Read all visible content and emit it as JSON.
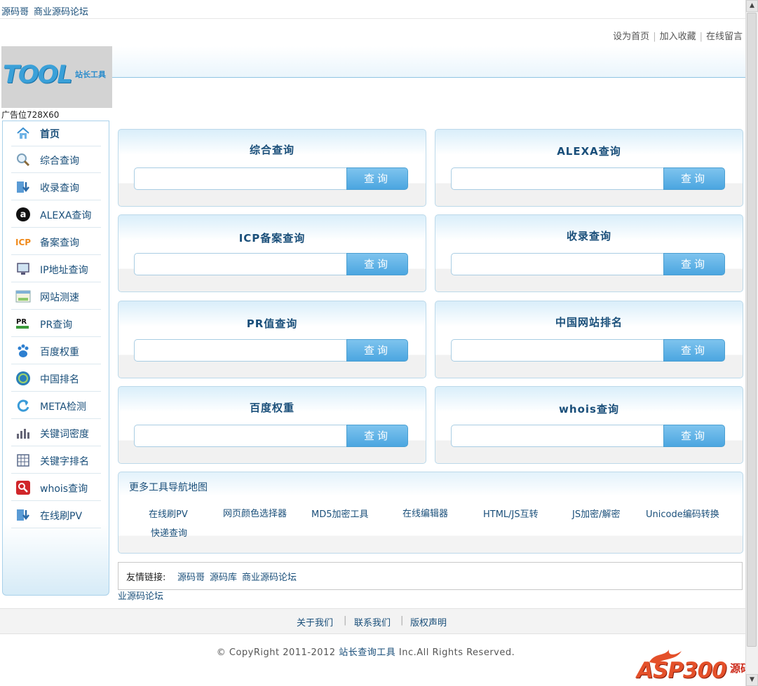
{
  "top": {
    "links": [
      "源码哥",
      "商业源码论坛"
    ],
    "right_links": [
      "设为首页",
      "加入收藏",
      "在线留言"
    ]
  },
  "logo": {
    "big": "TOOL",
    "small": "站长工具"
  },
  "ad_label": "广告位728X60",
  "sidebar": {
    "items": [
      {
        "label": "首页",
        "icon": "home-icon"
      },
      {
        "label": "综合查询",
        "icon": "magnifier-icon"
      },
      {
        "label": "收录查询",
        "icon": "download-arrow-icon"
      },
      {
        "label": "ALEXA查询",
        "icon": "alexa-icon"
      },
      {
        "label": "备案查询",
        "icon": "icp-icon"
      },
      {
        "label": "IP地址查询",
        "icon": "monitor-icon"
      },
      {
        "label": "网站测速",
        "icon": "speed-window-icon"
      },
      {
        "label": "PR查询",
        "icon": "pr-icon"
      },
      {
        "label": "百度权重",
        "icon": "paw-icon"
      },
      {
        "label": "中国排名",
        "icon": "globe-icon"
      },
      {
        "label": "META检测",
        "icon": "refresh-icon"
      },
      {
        "label": "关键词密度",
        "icon": "bar-chart-icon"
      },
      {
        "label": "关键字排名",
        "icon": "table-icon"
      },
      {
        "label": "whois查询",
        "icon": "whois-search-icon"
      },
      {
        "label": "在线刷PV",
        "icon": "download-arrow-icon"
      }
    ]
  },
  "panels": [
    {
      "title": "综合查询",
      "button": "查询"
    },
    {
      "title": "ALEXA查询",
      "button": "查询"
    },
    {
      "title": "ICP备案查询",
      "button": "查询"
    },
    {
      "title": "收录查询",
      "button": "查询"
    },
    {
      "title": "PR值查询",
      "button": "查询"
    },
    {
      "title": "中国网站排名",
      "button": "查询"
    },
    {
      "title": "百度权重",
      "button": "查询"
    },
    {
      "title": "whois查询",
      "button": "查询"
    }
  ],
  "more_tools": {
    "title": "更多工具导航地图",
    "links": [
      "在线刷PV",
      "网页颜色选择器",
      "MD5加密工具",
      "在线编辑器",
      "HTML/JS互转",
      "JS加密/解密",
      "Unicode编码转换",
      "快递查询"
    ]
  },
  "friends": {
    "label": "友情链接:",
    "links": [
      "源码哥",
      "源码库",
      "商业源码论坛"
    ],
    "extra": "业源码论坛"
  },
  "footer": {
    "links": [
      "关于我们",
      "联系我们",
      "版权声明"
    ],
    "copyright_pre": "© CopyRight 2011-2012 ",
    "copyright_brand": "站长查询工具",
    "copyright_post": " Inc.All Rights Reserved."
  },
  "watermark": {
    "main": "ASP300",
    "side": "源码"
  }
}
